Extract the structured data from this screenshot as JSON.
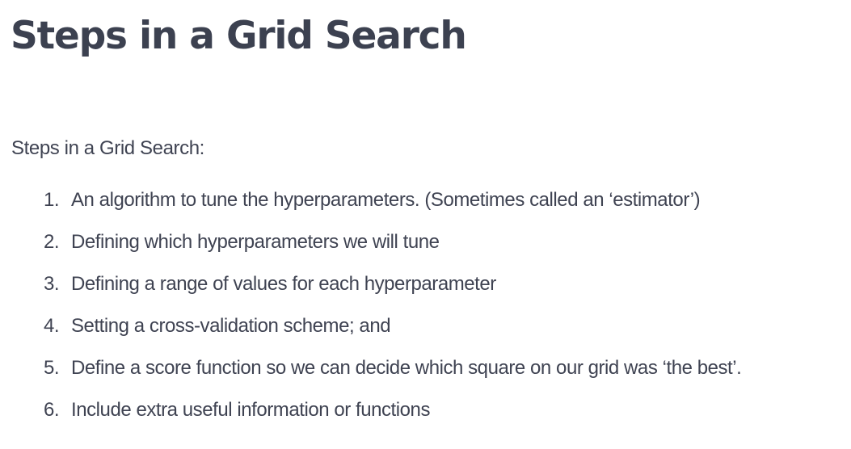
{
  "page": {
    "title": "Steps in a Grid Search",
    "intro": "Steps in a Grid Search:"
  },
  "steps": [
    {
      "number": "1.",
      "text": "An algorithm to tune the hyperparameters. (Sometimes called an ‘estimator’)"
    },
    {
      "number": "2.",
      "text": "Defining which hyperparameters we will tune"
    },
    {
      "number": "3.",
      "text": "Defining a range of values for each hyperparameter"
    },
    {
      "number": "4.",
      "text": "Setting a cross-validation scheme; and"
    },
    {
      "number": "5.",
      "text": "Define a score function so we can decide which square on our grid was ‘the best’."
    },
    {
      "number": "6.",
      "text": "Include extra useful information or functions"
    }
  ]
}
